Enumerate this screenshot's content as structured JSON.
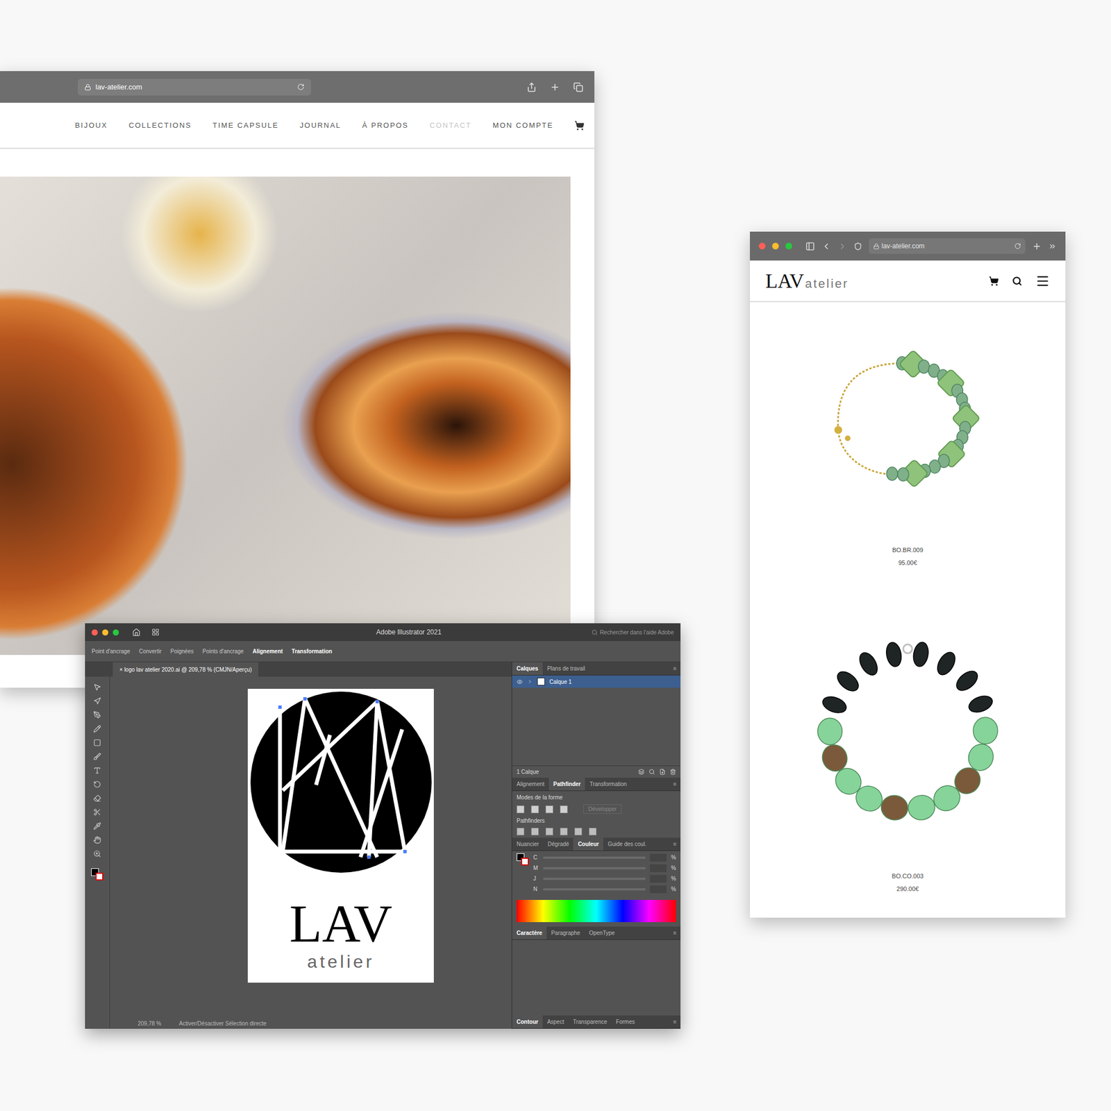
{
  "desktop_browser": {
    "address": "lav-atelier.com",
    "nav": [
      {
        "label": "BIJOUX",
        "selected": false
      },
      {
        "label": "COLLECTIONS",
        "selected": false
      },
      {
        "label": "TIME CAPSULE",
        "selected": false
      },
      {
        "label": "JOURNAL",
        "selected": false
      },
      {
        "label": "À PROPOS",
        "selected": false
      },
      {
        "label": "CONTACT",
        "selected": true
      },
      {
        "label": "MON COMPTE",
        "selected": false
      }
    ]
  },
  "illustrator": {
    "title": "Adobe Illustrator 2021",
    "search_placeholder": "Rechercher dans l'aide Adobe",
    "control_bar": [
      "Point d'ancrage",
      "Convertir",
      "Poignées",
      "Points d'ancrage",
      "Alignement",
      "Transformation"
    ],
    "document_tab": "logo lav atelier 2020.ai @ 209,78 % (CMJN/Aperçu)",
    "artboard_logo": {
      "title": "LAV",
      "subtitle": "atelier"
    },
    "layers_tabs": [
      {
        "label": "Calques",
        "selected": true
      },
      {
        "label": "Plans de travail",
        "selected": false
      }
    ],
    "layers": [
      {
        "name": "Calque 1",
        "visible": true,
        "selected": true
      }
    ],
    "layers_count": "1 Calque",
    "shape_tabs": [
      {
        "label": "Alignement",
        "selected": false
      },
      {
        "label": "Pathfinder",
        "selected": true
      },
      {
        "label": "Transformation",
        "selected": false
      }
    ],
    "shape_modes_label": "Modes de la forme",
    "expand_button": {
      "label": "Développer",
      "disabled": true
    },
    "pathfinders_label": "Pathfinders",
    "color_tabs": [
      {
        "label": "Nuancier",
        "selected": false
      },
      {
        "label": "Dégradé",
        "selected": false
      },
      {
        "label": "Couleur",
        "selected": true
      },
      {
        "label": "Guide des coul.",
        "selected": false
      }
    ],
    "color_channels": [
      {
        "name": "C",
        "unit": "%"
      },
      {
        "name": "M",
        "unit": "%"
      },
      {
        "name": "J",
        "unit": "%"
      },
      {
        "name": "N",
        "unit": "%"
      }
    ],
    "type_tabs": [
      {
        "label": "Caractère",
        "selected": true
      },
      {
        "label": "Paragraphe",
        "selected": false
      },
      {
        "label": "OpenType",
        "selected": false
      }
    ],
    "bottom_tabs": [
      {
        "label": "Contour",
        "selected": true
      },
      {
        "label": "Aspect",
        "selected": false
      },
      {
        "label": "Transparence",
        "selected": false
      },
      {
        "label": "Formes",
        "selected": false
      }
    ],
    "status": {
      "zoom": "209,78 %",
      "tool": "Activer/Désactiver Sélection directe"
    }
  },
  "mobile_browser": {
    "address": "lav-atelier.com",
    "logo": {
      "title": "LAV",
      "subtitle": "atelier"
    },
    "products": [
      {
        "code": "BO.BR.009",
        "price": "95.00€",
        "kind": "bracelet"
      },
      {
        "code": "BO.CO.003",
        "price": "290.00€",
        "kind": "necklace"
      }
    ]
  }
}
